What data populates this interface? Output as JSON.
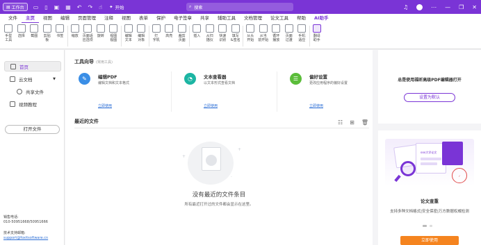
{
  "titlebar": {
    "workspace_label": "工作台",
    "start_label": "开始",
    "search_placeholder": "搜索",
    "accent": "#7a34d6"
  },
  "menu": {
    "items": [
      "文件",
      "主页",
      "视图",
      "编辑",
      "页面管理",
      "注释",
      "视图",
      "表单",
      "保护",
      "电子签章",
      "共享",
      "辅助工具",
      "文档管理",
      "论文工具",
      "帮助",
      "AI助手"
    ],
    "active_index": 1
  },
  "ribbon": {
    "items": [
      {
        "label": "手型\n工具",
        "icon": "hand-icon"
      },
      {
        "label": "选择",
        "icon": "select-icon"
      },
      {
        "label": "截图",
        "icon": "screenshot-icon"
      },
      {
        "label": "剪贴\n板",
        "icon": "clipboard-icon"
      },
      {
        "label": "书签",
        "icon": "bookmark-icon"
      },
      {
        "label": "缩放",
        "icon": "zoom-icon"
      },
      {
        "label": "页面适\n应选项",
        "icon": "fit-page-icon"
      },
      {
        "label": "旋转",
        "icon": "rotate-icon"
      },
      {
        "label": "视图\n视图",
        "icon": "view-icon"
      },
      {
        "label": "编辑\n文本",
        "icon": "edit-text-icon"
      },
      {
        "label": "编辑\n对象",
        "icon": "edit-object-icon"
      },
      {
        "label": "打\n字机",
        "icon": "typewriter-icon"
      },
      {
        "label": "高亮",
        "icon": "highlight-icon"
      },
      {
        "label": "裁剪\n页面",
        "icon": "crop-icon"
      },
      {
        "label": "插入",
        "icon": "insert-icon"
      },
      {
        "label": "从扫\n描仪",
        "icon": "scanner-icon"
      },
      {
        "label": "快速\n识别",
        "icon": "ocr-icon"
      },
      {
        "label": "填写\n&签名",
        "icon": "fill-sign-icon"
      },
      {
        "label": "从头\n开始",
        "icon": "play-icon"
      },
      {
        "label": "从当\n前开始",
        "icon": "play-current-icon"
      },
      {
        "label": "循环\n播放",
        "icon": "loop-icon"
      },
      {
        "label": "页面\n过渡",
        "icon": "transition-icon"
      },
      {
        "label": "手机\n适应",
        "icon": "mobile-icon"
      },
      {
        "label": "翻译\n助手",
        "icon": "translate-icon"
      }
    ]
  },
  "sidebar": {
    "home": "首页",
    "cloud": "云文档",
    "shared": "共享文件",
    "video": "视频教程",
    "open_file": "打开文件",
    "sales_label": "销售电话:",
    "sales_phone": "010-50951668/50951666",
    "support_label": "技术支持邮箱:",
    "support_email": "support@foxitsoftware.cn"
  },
  "guide": {
    "title": "工具向导",
    "subtitle": "(常用工具)",
    "cards": [
      {
        "title": "编辑PDF",
        "desc": "编辑文档和文本格式",
        "link": "立即使用",
        "color": "#3a8ee6",
        "icon": "edit-pdf-icon"
      },
      {
        "title": "文本查看器",
        "desc": "以文本形式查看文档",
        "link": "立即使用",
        "color": "#1cb5a3",
        "icon": "text-viewer-icon"
      },
      {
        "title": "偏好设置",
        "desc": "更改应用程序的偏好设置",
        "link": "立即使用",
        "color": "#5bbd3a",
        "icon": "settings-icon"
      }
    ]
  },
  "recent": {
    "title": "最近的文件",
    "empty_title": "没有最近的文件条目",
    "empty_sub": "所有最近打开过的文件都会显示在这里。"
  },
  "right_panel": {
    "default_title": "总是使用福昕高级PDF编辑器打开",
    "default_button": "设置为默认",
    "promo_sheet_text": "ooo大学论文",
    "promo_title": "论文查重",
    "promo_desc": "支持多种文档格式|安全保密|万方数据权威检测",
    "promo_button": "立即使用",
    "cta_color": "#f5841f"
  }
}
